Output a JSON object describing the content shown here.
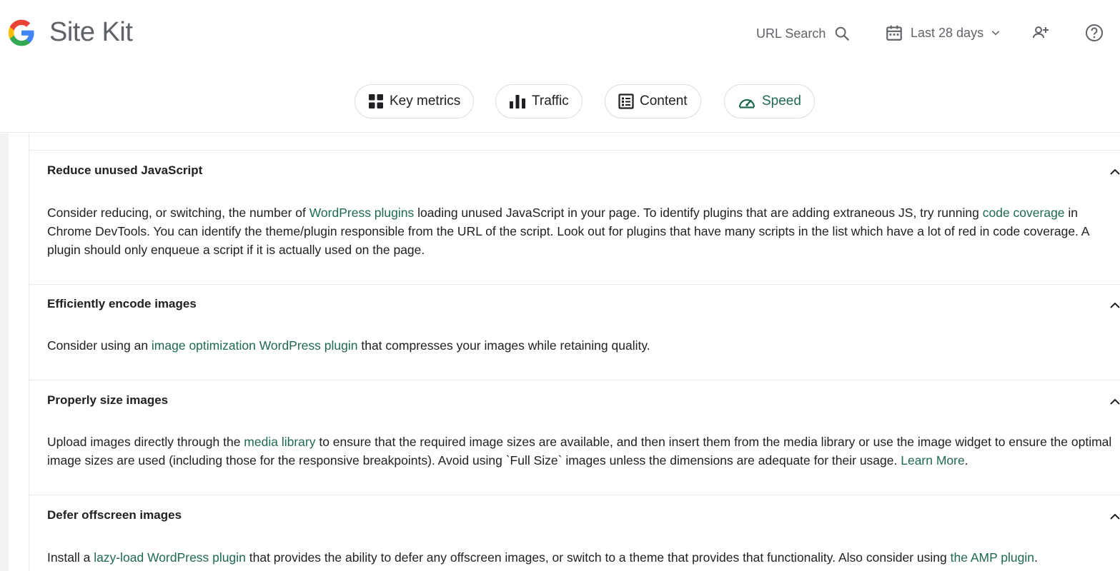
{
  "header": {
    "brand": "Site Kit",
    "url_search": "URL Search",
    "date_range": "Last 28 days"
  },
  "tabs": [
    {
      "label": "Key metrics",
      "icon": "grid-icon"
    },
    {
      "label": "Traffic",
      "icon": "bar-chart-icon"
    },
    {
      "label": "Content",
      "icon": "content-icon"
    },
    {
      "label": "Speed",
      "icon": "speedometer-icon",
      "active": true
    }
  ],
  "colors": {
    "link": "#1e6a4d",
    "muted": "#5f6368",
    "border": "#e8eaed"
  },
  "sections": [
    {
      "title": "Reduce unused JavaScript",
      "t1": "Consider reducing, or switching, the number of ",
      "l1": "WordPress plugins",
      "t2": " loading unused JavaScript in your page. To identify plugins that are adding extraneous JS, try running ",
      "l2": "code coverage",
      "t3": " in Chrome DevTools. You can identify the theme/plugin responsible from the URL of the script. Look out for plugins that have many scripts in the list which have a lot of red in code coverage. A plugin should only enqueue a script if it is actually used on the page."
    },
    {
      "title": "Efficiently encode images",
      "t1": "Consider using an ",
      "l1": "image optimization WordPress plugin",
      "t2": " that compresses your images while retaining quality."
    },
    {
      "title": "Properly size images",
      "t1": "Upload images directly through the ",
      "l1": "media library",
      "t2": " to ensure that the required image sizes are available, and then insert them from the media library or use the image widget to ensure the optimal image sizes are used (including those for the responsive breakpoints). Avoid using `Full Size` images unless the dimensions are adequate for their usage. ",
      "l2": "Learn More",
      "t3": "."
    },
    {
      "title": "Defer offscreen images",
      "t1": "Install a ",
      "l1": "lazy-load WordPress plugin",
      "t2": " that provides the ability to defer any offscreen images, or switch to a theme that provides that functionality. Also consider using ",
      "l2": "the AMP plugin",
      "t3": "."
    }
  ]
}
